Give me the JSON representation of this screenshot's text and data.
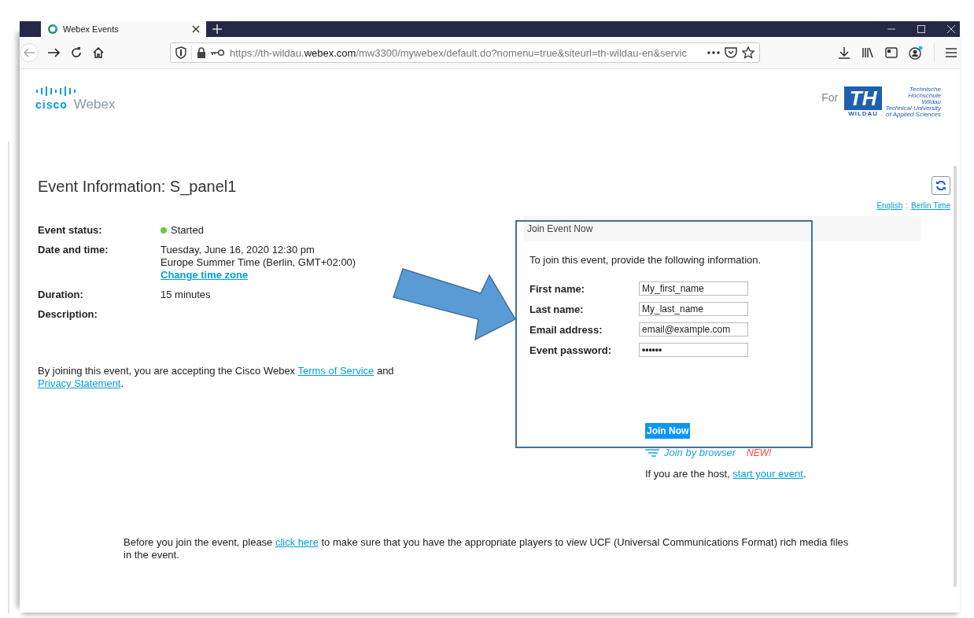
{
  "browser": {
    "tab": {
      "title": "Webex Events"
    },
    "url": {
      "prefix": "https://th-wildau.",
      "domain": "webex.com",
      "path": "/mw3300/mywebex/default.do?nomenu=true&siteurl=th-wildau-en&servic"
    }
  },
  "header": {
    "brand": "cisco",
    "product": "Webex",
    "for_label": "For",
    "partner": {
      "mark": "TH",
      "name_lines": [
        "Technische",
        "Hochschule",
        "Wildau",
        "Technical University",
        "of Applied Sciences"
      ],
      "subtitle": "WILDAU"
    }
  },
  "event": {
    "title": "Event Information: S_panel1",
    "language_links": [
      "English",
      "Berlin Time"
    ],
    "separator": ":",
    "details": [
      {
        "label": "Event status:",
        "kind": "status",
        "value": "Started",
        "color": "#6cc644"
      },
      {
        "label": "Date and time:",
        "kind": "lines",
        "lines": [
          "Tuesday, June 16, 2020 12:30 pm",
          "Europe Summer Time (Berlin, GMT+02:00)"
        ],
        "link": "Change time zone"
      },
      {
        "label": "Duration:",
        "kind": "text",
        "value": "15 minutes"
      },
      {
        "label": "Description:",
        "kind": "text"
      }
    ],
    "terms": {
      "before": "By joining this event, you are accepting the Cisco Webex ",
      "link1": "Terms of Service",
      "middle": " and ",
      "link2": "Privacy Statement",
      "after": "."
    }
  },
  "join_panel": {
    "title": "Join Event Now",
    "intro": "To join this event, provide the following information.",
    "fields": [
      {
        "label": "First name:",
        "value": "My_first_name",
        "kind": "text"
      },
      {
        "label": "Last name:",
        "value": "My_last_name",
        "kind": "text"
      },
      {
        "label": "Email address:",
        "value": "email@example.com",
        "kind": "text"
      },
      {
        "label": "Event password:",
        "value": "••••••",
        "kind": "password"
      }
    ],
    "button": "Join Now",
    "browser_link": "Join by browser",
    "new_badge": "NEW!",
    "host": {
      "before": "If you are the host, ",
      "link": "start your event",
      "after": "."
    }
  },
  "players_note": {
    "before": "Before you join the event, please ",
    "link": "click here",
    "after": " to make sure that you have the appropriate players to view UCF (Universal Communications Format) rich media files in the event."
  }
}
